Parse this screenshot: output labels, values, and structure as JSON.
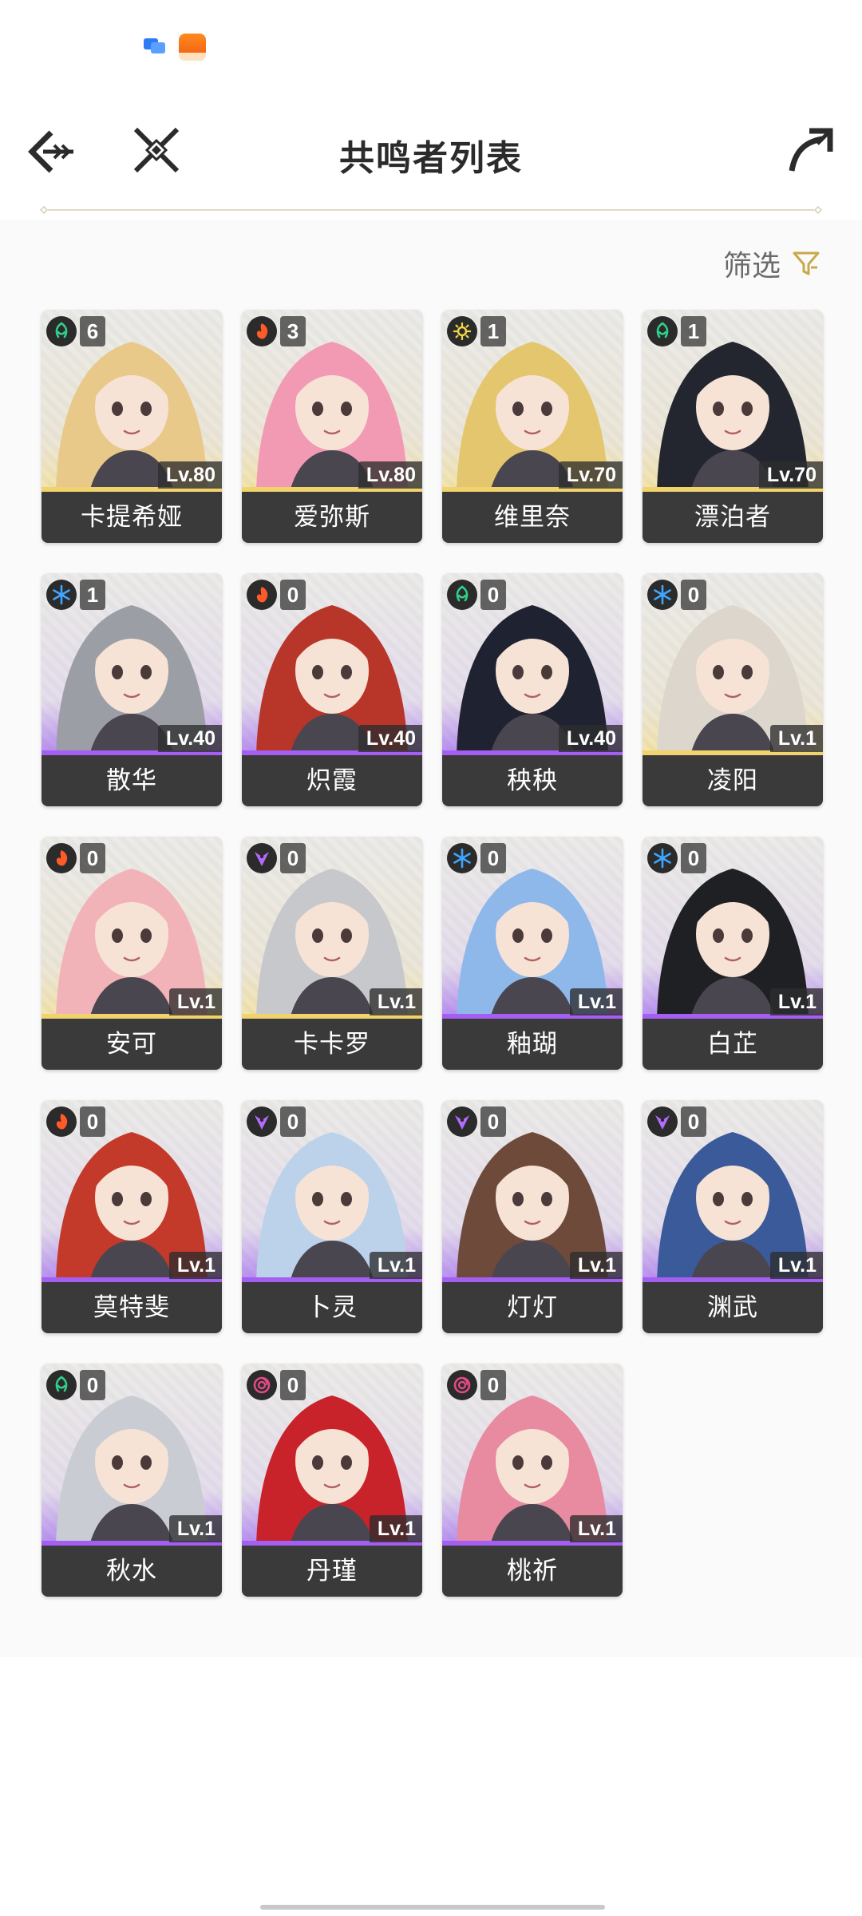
{
  "header": {
    "title": "共鸣者列表"
  },
  "filter": {
    "label": "筛选"
  },
  "colors": {
    "gold_rarity": "#f1d36d",
    "purple_rarity": "#a45ef2",
    "name_plate": "#3a3a3a",
    "accent_filter": "#c9a84a",
    "element": {
      "aero": "#2fd08a",
      "fusion": "#ff5a2a",
      "spectro": "#f2d54a",
      "glacio": "#3fa6ff",
      "electro": "#b36bff",
      "havoc": "#e04a86"
    }
  },
  "resonators": [
    {
      "name": "卡提希娅",
      "rank": "6",
      "level": "Lv.80",
      "element": "aero",
      "rarity": "gold",
      "hair": "#e8c98a"
    },
    {
      "name": "爱弥斯",
      "rank": "3",
      "level": "Lv.80",
      "element": "fusion",
      "rarity": "gold",
      "hair": "#f29ab3"
    },
    {
      "name": "维里奈",
      "rank": "1",
      "level": "Lv.70",
      "element": "spectro",
      "rarity": "gold",
      "hair": "#e3c66d"
    },
    {
      "name": "漂泊者",
      "rank": "1",
      "level": "Lv.70",
      "element": "aero",
      "rarity": "gold",
      "hair": "#23262f"
    },
    {
      "name": "散华",
      "rank": "1",
      "level": "Lv.40",
      "element": "glacio",
      "rarity": "purple",
      "hair": "#9c9ea6"
    },
    {
      "name": "炽霞",
      "rank": "0",
      "level": "Lv.40",
      "element": "fusion",
      "rarity": "purple",
      "hair": "#b8352a"
    },
    {
      "name": "秧秧",
      "rank": "0",
      "level": "Lv.40",
      "element": "aero",
      "rarity": "purple",
      "hair": "#1f2230"
    },
    {
      "name": "凌阳",
      "rank": "0",
      "level": "Lv.1",
      "element": "glacio",
      "rarity": "gold",
      "hair": "#dcd6cc"
    },
    {
      "name": "安可",
      "rank": "0",
      "level": "Lv.1",
      "element": "fusion",
      "rarity": "gold",
      "hair": "#f2b3b8"
    },
    {
      "name": "卡卡罗",
      "rank": "0",
      "level": "Lv.1",
      "element": "electro",
      "rarity": "gold",
      "hair": "#c6c8cc"
    },
    {
      "name": "釉瑚",
      "rank": "0",
      "level": "Lv.1",
      "element": "glacio",
      "rarity": "purple",
      "hair": "#8fb8ea"
    },
    {
      "name": "白芷",
      "rank": "0",
      "level": "Lv.1",
      "element": "glacio",
      "rarity": "purple",
      "hair": "#1e2024"
    },
    {
      "name": "莫特斐",
      "rank": "0",
      "level": "Lv.1",
      "element": "fusion",
      "rarity": "purple",
      "hair": "#c33a2a"
    },
    {
      "name": "卜灵",
      "rank": "0",
      "level": "Lv.1",
      "element": "electro",
      "rarity": "purple",
      "hair": "#bcd2ea"
    },
    {
      "name": "灯灯",
      "rank": "0",
      "level": "Lv.1",
      "element": "electro",
      "rarity": "purple",
      "hair": "#6e4a3a"
    },
    {
      "name": "渊武",
      "rank": "0",
      "level": "Lv.1",
      "element": "electro",
      "rarity": "purple",
      "hair": "#3a5a9a"
    },
    {
      "name": "秋水",
      "rank": "0",
      "level": "Lv.1",
      "element": "aero",
      "rarity": "purple",
      "hair": "#c9ccd2"
    },
    {
      "name": "丹瑾",
      "rank": "0",
      "level": "Lv.1",
      "element": "havoc",
      "rarity": "purple",
      "hair": "#c8232a"
    },
    {
      "name": "桃祈",
      "rank": "0",
      "level": "Lv.1",
      "element": "havoc",
      "rarity": "purple",
      "hair": "#e88aa0"
    }
  ]
}
